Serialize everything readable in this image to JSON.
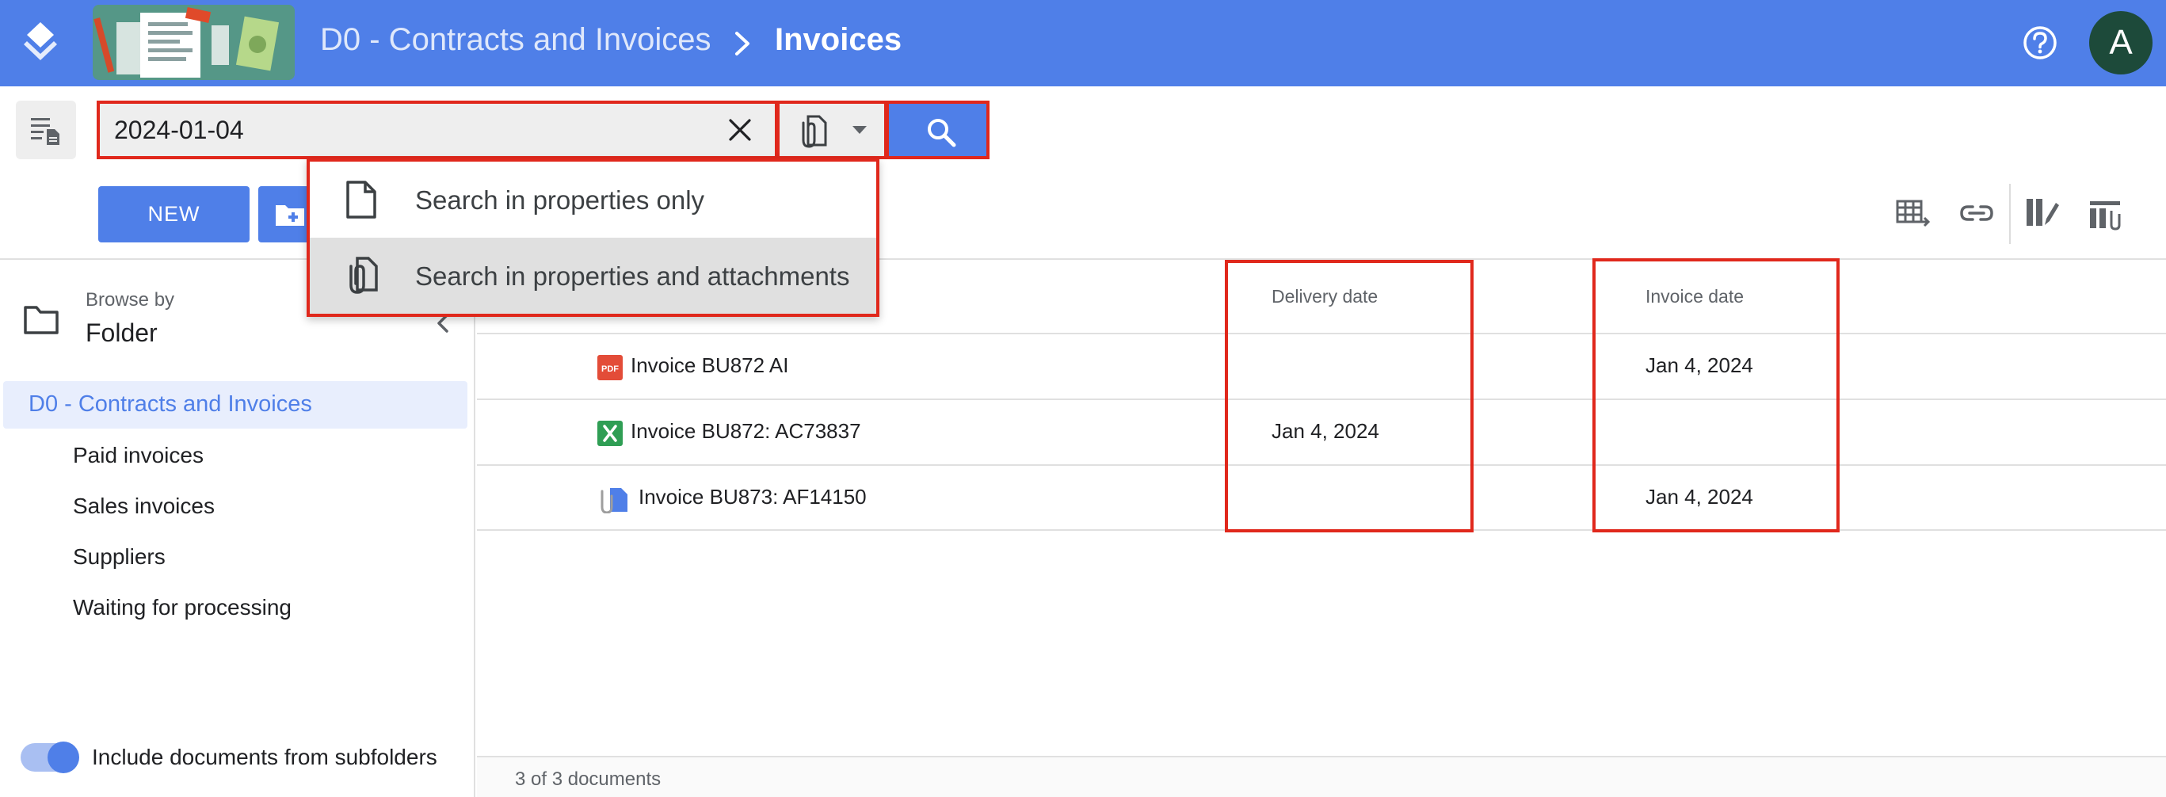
{
  "theme": {
    "accent": "#4f7fe8",
    "highlight": "#e0281c"
  },
  "header": {
    "breadcrumb_root": "D0 - Contracts and Invoices",
    "breadcrumb_current": "Invoices",
    "avatar_initial": "A"
  },
  "search": {
    "value": "2024-01-04",
    "menu": [
      {
        "label": "Search in properties only",
        "icon": "file-icon"
      },
      {
        "label": "Search in properties and attachments",
        "icon": "paperclip-file-icon",
        "selected": true
      }
    ]
  },
  "actions": {
    "new_label": "NEW"
  },
  "sidebar": {
    "browse_by_label": "Browse by",
    "browse_by_value": "Folder",
    "root": "D0 - Contracts and Invoices",
    "items": [
      "Paid invoices",
      "Sales invoices",
      "Suppliers",
      "Waiting for processing"
    ],
    "include_subfolders_label": "Include documents from subfolders",
    "include_subfolders": true
  },
  "table": {
    "columns": {
      "delivery_date": "Delivery date",
      "invoice_date": "Invoice date"
    },
    "rows": [
      {
        "icon": "pdf-icon",
        "name": "Invoice BU872 AI",
        "delivery_date": "",
        "invoice_date": "Jan 4, 2024"
      },
      {
        "icon": "excel-icon",
        "name": "Invoice BU872: AC73837",
        "delivery_date": "Jan 4, 2024",
        "invoice_date": ""
      },
      {
        "icon": "attachment-doc-icon",
        "name": "Invoice BU873: AF14150",
        "delivery_date": "",
        "invoice_date": "Jan 4, 2024"
      }
    ],
    "footer": "3 of 3 documents"
  }
}
